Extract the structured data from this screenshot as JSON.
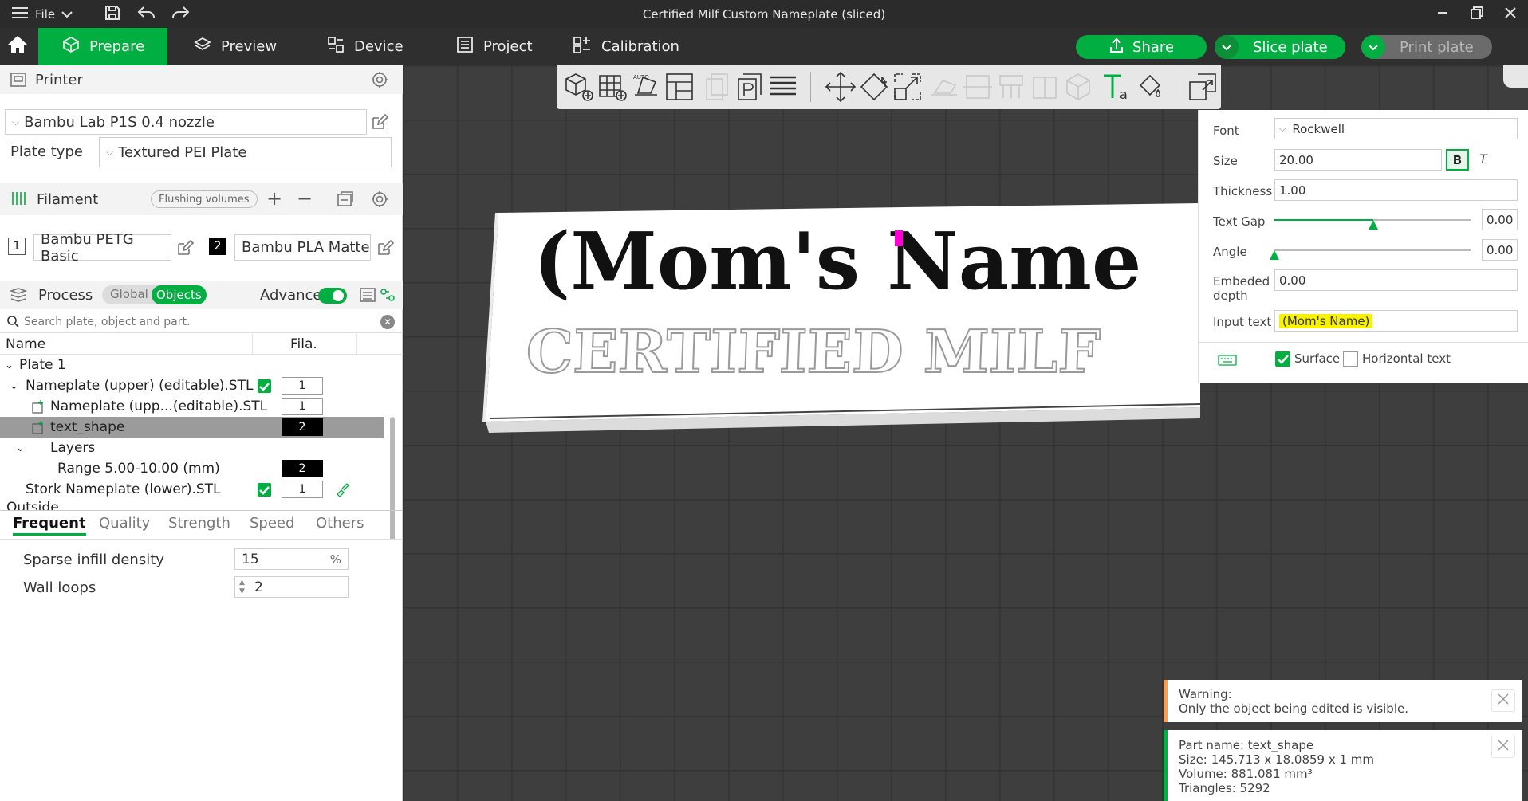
{
  "window": {
    "title": "Certified Milf Custom Nameplate (sliced)",
    "file_menu_label": "File"
  },
  "tabs": {
    "prepare": "Prepare",
    "preview": "Preview",
    "device": "Device",
    "project": "Project",
    "calibration": "Calibration"
  },
  "actions": {
    "share": "Share",
    "slice_plate": "Slice plate",
    "print_plate": "Print plate"
  },
  "printer": {
    "section_title": "Printer",
    "selected_printer": "Bambu Lab P1S 0.4 nozzle",
    "plate_type_label": "Plate type",
    "plate_type_value": "Textured PEI Plate"
  },
  "filament": {
    "section_title": "Filament",
    "flushing_volumes_label": "Flushing volumes",
    "slots": [
      {
        "number": "1",
        "name": "Bambu PETG Basic",
        "swatch": "#ffffff"
      },
      {
        "number": "2",
        "name": "Bambu PLA Matte",
        "swatch": "#000000"
      }
    ]
  },
  "process": {
    "section_title": "Process",
    "toggle_global": "Global",
    "toggle_objects": "Objects",
    "advance_label": "Advance",
    "advance_on": true,
    "search_placeholder": "Search plate, object and part.",
    "tree_header_name": "Name",
    "tree_header_fila": "Fila.",
    "tree": [
      {
        "label": "Plate 1"
      },
      {
        "label": "Nameplate (upper) (editable).STL",
        "fila": "1",
        "checked": true
      },
      {
        "label": "Nameplate (upp...(editable).STL",
        "fila": "1"
      },
      {
        "label": "text_shape",
        "fila": "2",
        "selected": true
      },
      {
        "label": "Layers"
      },
      {
        "label": "Range 5.00-10.00 (mm)",
        "fila": "2"
      },
      {
        "label": "Stork Nameplate (lower).STL",
        "fila": "1",
        "checked": true
      },
      {
        "label": "Outside"
      }
    ],
    "subtabs": [
      "Frequent",
      "Quality",
      "Strength",
      "Speed",
      "Others"
    ],
    "active_subtab": "Frequent",
    "params": [
      {
        "label": "Sparse infill density",
        "value": "15",
        "unit": "%"
      },
      {
        "label": "Wall loops",
        "value": "2",
        "unit": ""
      }
    ]
  },
  "model": {
    "main_text": "(Mom's Name",
    "embossed_text": "CERTIFIED MILF"
  },
  "text_tool": {
    "font_label": "Font",
    "font_value": "Rockwell",
    "size_label": "Size",
    "size_value": "20.00",
    "bold_label": "B",
    "italic_label": "T",
    "thickness_label": "Thickness",
    "thickness_value": "1.00",
    "text_gap_label": "Text Gap",
    "text_gap_value": "0.00",
    "text_gap_fraction": 0.5,
    "angle_label": "Angle",
    "angle_value": "0.00",
    "angle_fraction": 0.0,
    "embeded_depth_label_1": "Embeded",
    "embeded_depth_label_2": "depth",
    "embeded_depth_value": "0.00",
    "input_text_label": "Input text",
    "input_text_value": "(Mom's Name)",
    "surface_label": "Surface",
    "surface_checked": true,
    "horizontal_text_label": "Horizontal text",
    "horizontal_text_checked": false
  },
  "notifications": {
    "warning_title": "Warning:",
    "warning_body": "Only the object being edited is visible.",
    "part_name": "Part name: text_shape",
    "part_size": "Size: 145.713 x 18.0859 x 1 mm",
    "part_volume": "Volume: 881.081 mm³",
    "part_triangles": "Triangles: 5292"
  },
  "colors": {
    "accent": "#00ae42",
    "toolbar_bg": "#2f2f2f",
    "titlebar_bg": "#2b2b2b",
    "viewport_bg": "#3e3e3e",
    "warning": "#f5a05a",
    "highlight": "#f6f200"
  }
}
